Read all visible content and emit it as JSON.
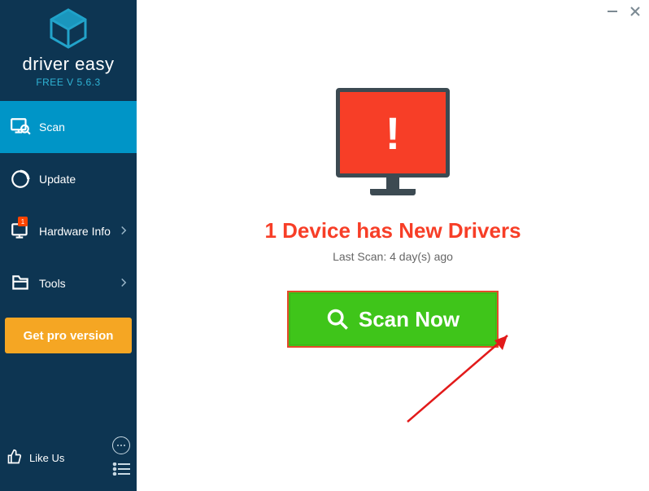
{
  "brand": {
    "name": "driver easy",
    "version": "FREE V 5.6.3"
  },
  "sidebar": {
    "items": [
      {
        "label": "Scan"
      },
      {
        "label": "Update"
      },
      {
        "label": "Hardware Info"
      },
      {
        "label": "Tools"
      }
    ],
    "hardware_badge": "1",
    "pro_label": "Get pro version",
    "like_label": "Like Us"
  },
  "main": {
    "headline": "1 Device has New Drivers",
    "subline": "Last Scan: 4 day(s) ago",
    "scan_label": "Scan Now",
    "alert_mark": "!"
  }
}
